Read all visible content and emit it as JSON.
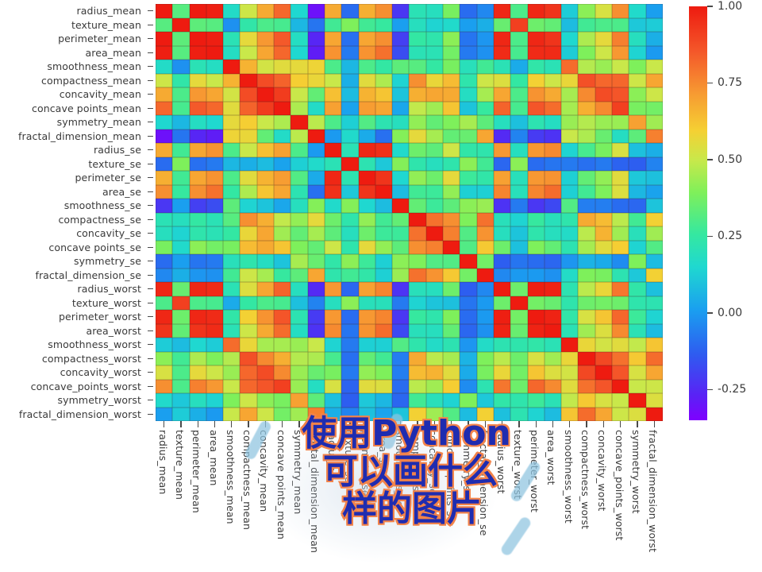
{
  "figure": {
    "axis_tick_color": "#4a4a4a",
    "label_color": "#3a3a3a",
    "colormap": "jet"
  },
  "overlay": {
    "lines": [
      "使用Python",
      "可以画什么",
      "样的图片"
    ],
    "fill_color": "#1f2cb0",
    "stroke_color": "#f2834a"
  },
  "colorbar": {
    "ticks": [
      "1.00",
      "0.75",
      "0.50",
      "0.25",
      "0.00",
      "-0.25"
    ],
    "tick_values": [
      1.0,
      0.75,
      0.5,
      0.25,
      0.0,
      -0.25
    ],
    "vmin": -0.35,
    "vmax": 1.0
  },
  "chart_data": {
    "type": "heatmap",
    "title": "",
    "xlabel": "",
    "ylabel": "",
    "cmap": "jet",
    "vmin": -0.35,
    "vmax": 1.0,
    "grid": false,
    "legend_position": "right",
    "categories": [
      "radius_mean",
      "texture_mean",
      "perimeter_mean",
      "area_mean",
      "smoothness_mean",
      "compactness_mean",
      "concavity_mean",
      "concave points_mean",
      "symmetry_mean",
      "fractal_dimension_mean",
      "radius_se",
      "texture_se",
      "perimeter_se",
      "area_se",
      "smoothness_se",
      "compactness_se",
      "concavity_se",
      "concave points_se",
      "symmetry_se",
      "fractal_dimension_se",
      "radius_worst",
      "texture_worst",
      "perimeter_worst",
      "area_worst",
      "smoothness_worst",
      "compactness_worst",
      "concavity_worst",
      "concave_points_worst",
      "symmetry_worst",
      "fractal_dimension_worst"
    ],
    "x": [
      "radius_mean",
      "texture_mean",
      "perimeter_mean",
      "area_mean",
      "smoothness_mean",
      "compactness_mean",
      "concavity_mean",
      "concave points_mean",
      "symmetry_mean",
      "fractal_dimension_mean",
      "radius_se",
      "texture_se",
      "perimeter_se",
      "area_se",
      "smoothness_se",
      "compactness_se",
      "concavity_se",
      "concave points_se",
      "symmetry_se",
      "fractal_dimension_se",
      "radius_worst",
      "texture_worst",
      "perimeter_worst",
      "area_worst",
      "smoothness_worst",
      "compactness_worst",
      "concavity_worst",
      "concave_points_worst",
      "symmetry_worst",
      "fractal_dimension_worst"
    ],
    "y": [
      "radius_mean",
      "texture_mean",
      "perimeter_mean",
      "area_mean",
      "smoothness_mean",
      "compactness_mean",
      "concavity_mean",
      "concave points_mean",
      "symmetry_mean",
      "fractal_dimension_mean",
      "radius_se",
      "texture_se",
      "perimeter_se",
      "area_se",
      "smoothness_se",
      "compactness_se",
      "concavity_se",
      "concave points_se",
      "symmetry_se",
      "fractal_dimension_se",
      "radius_worst",
      "texture_worst",
      "perimeter_worst",
      "area_worst",
      "smoothness_worst",
      "compactness_worst",
      "concavity_worst",
      "concave_points_worst",
      "symmetry_worst",
      "fractal_dimension_worst"
    ],
    "values": [
      [
        1.0,
        0.32,
        1.0,
        0.99,
        0.17,
        0.51,
        0.68,
        0.82,
        0.15,
        -0.31,
        0.68,
        -0.1,
        0.67,
        0.74,
        -0.22,
        0.21,
        0.19,
        0.38,
        -0.1,
        -0.04,
        0.97,
        0.3,
        0.97,
        0.94,
        0.12,
        0.41,
        0.53,
        0.74,
        0.16,
        0.01
      ],
      [
        0.32,
        1.0,
        0.33,
        0.32,
        -0.02,
        0.24,
        0.3,
        0.29,
        0.07,
        -0.08,
        0.28,
        0.39,
        0.28,
        0.26,
        0.01,
        0.19,
        0.14,
        0.16,
        0.01,
        0.05,
        0.35,
        0.91,
        0.36,
        0.34,
        0.08,
        0.28,
        0.3,
        0.3,
        0.11,
        0.12
      ],
      [
        1.0,
        0.33,
        1.0,
        0.99,
        0.21,
        0.56,
        0.72,
        0.85,
        0.18,
        -0.26,
        0.69,
        -0.09,
        0.69,
        0.74,
        -0.2,
        0.25,
        0.23,
        0.41,
        -0.08,
        -0.01,
        0.97,
        0.3,
        0.97,
        0.94,
        0.15,
        0.46,
        0.56,
        0.77,
        0.19,
        0.05
      ],
      [
        0.99,
        0.32,
        0.99,
        1.0,
        0.18,
        0.5,
        0.69,
        0.82,
        0.15,
        -0.28,
        0.73,
        -0.07,
        0.73,
        0.8,
        -0.17,
        0.21,
        0.21,
        0.37,
        -0.07,
        -0.02,
        0.96,
        0.29,
        0.96,
        0.96,
        0.12,
        0.39,
        0.51,
        0.72,
        0.14,
        0.0
      ],
      [
        0.17,
        -0.02,
        0.21,
        0.18,
        1.0,
        0.66,
        0.52,
        0.55,
        0.56,
        0.58,
        0.3,
        0.07,
        0.3,
        0.25,
        0.33,
        0.32,
        0.25,
        0.38,
        0.2,
        0.28,
        0.21,
        0.04,
        0.24,
        0.21,
        0.81,
        0.47,
        0.43,
        0.5,
        0.39,
        0.5
      ],
      [
        0.51,
        0.24,
        0.56,
        0.5,
        0.66,
        1.0,
        0.88,
        0.83,
        0.6,
        0.57,
        0.5,
        0.05,
        0.55,
        0.46,
        0.14,
        0.74,
        0.57,
        0.64,
        0.23,
        0.51,
        0.54,
        0.25,
        0.59,
        0.51,
        0.57,
        0.87,
        0.82,
        0.82,
        0.51,
        0.69
      ],
      [
        0.68,
        0.3,
        0.72,
        0.69,
        0.52,
        0.88,
        1.0,
        0.92,
        0.5,
        0.34,
        0.63,
        0.08,
        0.66,
        0.62,
        0.1,
        0.67,
        0.69,
        0.68,
        0.18,
        0.45,
        0.69,
        0.3,
        0.73,
        0.68,
        0.45,
        0.75,
        0.88,
        0.86,
        0.41,
        0.51
      ],
      [
        0.82,
        0.29,
        0.85,
        0.82,
        0.55,
        0.83,
        0.92,
        1.0,
        0.46,
        0.17,
        0.7,
        0.02,
        0.71,
        0.69,
        0.03,
        0.49,
        0.44,
        0.62,
        0.1,
        0.26,
        0.83,
        0.29,
        0.86,
        0.81,
        0.45,
        0.67,
        0.75,
        0.91,
        0.38,
        0.37
      ],
      [
        0.15,
        0.07,
        0.18,
        0.15,
        0.56,
        0.6,
        0.5,
        0.46,
        1.0,
        0.48,
        0.3,
        0.13,
        0.31,
        0.22,
        0.19,
        0.42,
        0.34,
        0.39,
        0.45,
        0.33,
        0.19,
        0.09,
        0.22,
        0.18,
        0.43,
        0.47,
        0.43,
        0.43,
        0.7,
        0.44
      ],
      [
        -0.31,
        -0.08,
        -0.26,
        -0.28,
        0.58,
        0.57,
        0.34,
        0.17,
        0.48,
        1.0,
        0.0,
        0.16,
        0.04,
        -0.09,
        0.4,
        0.56,
        0.45,
        0.34,
        0.35,
        0.69,
        -0.25,
        -0.05,
        -0.21,
        -0.23,
        0.5,
        0.46,
        0.35,
        0.18,
        0.33,
        0.77
      ],
      [
        0.68,
        0.28,
        0.69,
        0.73,
        0.3,
        0.5,
        0.63,
        0.7,
        0.3,
        0.0,
        1.0,
        0.21,
        0.97,
        0.95,
        0.16,
        0.36,
        0.33,
        0.51,
        0.24,
        0.23,
        0.72,
        0.19,
        0.72,
        0.75,
        0.14,
        0.29,
        0.38,
        0.53,
        0.09,
        0.05
      ],
      [
        -0.1,
        0.39,
        -0.09,
        -0.07,
        0.07,
        0.05,
        0.08,
        0.02,
        0.13,
        0.16,
        0.21,
        1.0,
        0.22,
        0.11,
        0.4,
        0.23,
        0.19,
        0.23,
        0.41,
        0.28,
        -0.11,
        0.41,
        -0.1,
        -0.08,
        -0.07,
        -0.09,
        -0.07,
        -0.12,
        -0.13,
        -0.05
      ],
      [
        0.67,
        0.28,
        0.69,
        0.73,
        0.3,
        0.55,
        0.66,
        0.71,
        0.31,
        0.04,
        0.97,
        0.22,
        1.0,
        0.94,
        0.15,
        0.42,
        0.36,
        0.56,
        0.27,
        0.24,
        0.7,
        0.2,
        0.72,
        0.73,
        0.13,
        0.34,
        0.42,
        0.55,
        0.11,
        0.09
      ],
      [
        0.74,
        0.26,
        0.74,
        0.8,
        0.25,
        0.46,
        0.62,
        0.69,
        0.22,
        -0.09,
        0.95,
        0.11,
        0.94,
        1.0,
        0.08,
        0.28,
        0.27,
        0.42,
        0.13,
        0.13,
        0.76,
        0.2,
        0.76,
        0.81,
        0.13,
        0.28,
        0.39,
        0.54,
        0.07,
        0.02
      ],
      [
        -0.22,
        0.01,
        -0.2,
        -0.17,
        0.33,
        0.14,
        0.1,
        0.03,
        0.19,
        0.4,
        0.16,
        0.4,
        0.15,
        0.08,
        1.0,
        0.34,
        0.27,
        0.33,
        0.41,
        0.43,
        -0.23,
        -0.07,
        -0.22,
        -0.18,
        0.31,
        -0.06,
        -0.06,
        -0.1,
        -0.11,
        0.1
      ],
      [
        0.21,
        0.19,
        0.25,
        0.21,
        0.32,
        0.74,
        0.67,
        0.49,
        0.42,
        0.56,
        0.36,
        0.23,
        0.42,
        0.28,
        0.34,
        1.0,
        0.8,
        0.74,
        0.39,
        0.8,
        0.2,
        0.14,
        0.26,
        0.2,
        0.23,
        0.68,
        0.64,
        0.48,
        0.28,
        0.59
      ],
      [
        0.19,
        0.14,
        0.23,
        0.21,
        0.25,
        0.57,
        0.69,
        0.44,
        0.34,
        0.45,
        0.33,
        0.19,
        0.36,
        0.27,
        0.27,
        0.8,
        1.0,
        0.77,
        0.31,
        0.73,
        0.19,
        0.1,
        0.23,
        0.19,
        0.17,
        0.48,
        0.66,
        0.44,
        0.2,
        0.44
      ],
      [
        0.38,
        0.16,
        0.41,
        0.37,
        0.38,
        0.64,
        0.68,
        0.62,
        0.39,
        0.34,
        0.51,
        0.23,
        0.56,
        0.42,
        0.33,
        0.74,
        0.77,
        1.0,
        0.31,
        0.61,
        0.36,
        0.09,
        0.39,
        0.34,
        0.22,
        0.45,
        0.55,
        0.6,
        0.14,
        0.31
      ],
      [
        -0.1,
        0.01,
        -0.08,
        -0.07,
        0.2,
        0.23,
        0.18,
        0.1,
        0.45,
        0.35,
        0.24,
        0.41,
        0.27,
        0.13,
        0.41,
        0.39,
        0.31,
        0.31,
        1.0,
        0.37,
        -0.13,
        -0.08,
        -0.1,
        -0.11,
        -0.01,
        0.06,
        0.04,
        -0.03,
        0.39,
        0.08
      ],
      [
        -0.04,
        0.05,
        -0.01,
        -0.02,
        0.28,
        0.51,
        0.45,
        0.26,
        0.33,
        0.69,
        0.23,
        0.28,
        0.24,
        0.13,
        0.43,
        0.8,
        0.73,
        0.61,
        0.37,
        1.0,
        -0.04,
        -0.0,
        -0.0,
        -0.02,
        0.17,
        0.39,
        0.38,
        0.22,
        0.11,
        0.59
      ],
      [
        0.97,
        0.35,
        0.97,
        0.96,
        0.21,
        0.54,
        0.69,
        0.83,
        0.19,
        -0.25,
        0.72,
        -0.11,
        0.7,
        0.76,
        -0.23,
        0.2,
        0.19,
        0.36,
        -0.13,
        -0.04,
        1.0,
        0.36,
        0.99,
        0.98,
        0.22,
        0.48,
        0.57,
        0.79,
        0.24,
        0.09
      ],
      [
        0.3,
        0.91,
        0.3,
        0.29,
        0.04,
        0.25,
        0.3,
        0.29,
        0.09,
        -0.05,
        0.19,
        0.41,
        0.2,
        0.2,
        -0.07,
        0.14,
        0.1,
        0.09,
        -0.08,
        -0.0,
        0.36,
        1.0,
        0.37,
        0.35,
        0.23,
        0.36,
        0.37,
        0.36,
        0.23,
        0.22
      ],
      [
        0.97,
        0.36,
        0.97,
        0.96,
        0.24,
        0.59,
        0.73,
        0.86,
        0.22,
        -0.21,
        0.72,
        -0.1,
        0.72,
        0.76,
        -0.22,
        0.26,
        0.23,
        0.39,
        -0.1,
        -0.0,
        0.99,
        0.37,
        1.0,
        0.98,
        0.24,
        0.53,
        0.62,
        0.82,
        0.27,
        0.14
      ],
      [
        0.94,
        0.34,
        0.94,
        0.96,
        0.21,
        0.51,
        0.68,
        0.81,
        0.18,
        -0.23,
        0.75,
        -0.08,
        0.73,
        0.81,
        -0.18,
        0.2,
        0.19,
        0.34,
        -0.11,
        -0.02,
        0.98,
        0.35,
        0.98,
        1.0,
        0.21,
        0.44,
        0.54,
        0.75,
        0.21,
        0.08
      ],
      [
        0.12,
        0.08,
        0.15,
        0.12,
        0.81,
        0.57,
        0.45,
        0.45,
        0.43,
        0.5,
        0.14,
        -0.07,
        0.13,
        0.13,
        0.31,
        0.23,
        0.17,
        0.22,
        -0.01,
        0.17,
        0.22,
        0.23,
        0.24,
        0.21,
        1.0,
        0.57,
        0.52,
        0.55,
        0.49,
        0.62
      ],
      [
        0.41,
        0.28,
        0.46,
        0.39,
        0.47,
        0.87,
        0.75,
        0.67,
        0.47,
        0.46,
        0.29,
        -0.09,
        0.34,
        0.28,
        -0.06,
        0.68,
        0.48,
        0.45,
        0.06,
        0.39,
        0.48,
        0.36,
        0.53,
        0.44,
        0.57,
        1.0,
        0.89,
        0.8,
        0.61,
        0.81
      ],
      [
        0.53,
        0.3,
        0.56,
        0.51,
        0.43,
        0.82,
        0.88,
        0.75,
        0.43,
        0.35,
        0.38,
        -0.07,
        0.42,
        0.39,
        -0.06,
        0.64,
        0.66,
        0.55,
        0.04,
        0.38,
        0.57,
        0.37,
        0.62,
        0.54,
        0.52,
        0.89,
        1.0,
        0.86,
        0.53,
        0.69
      ],
      [
        0.74,
        0.3,
        0.77,
        0.72,
        0.5,
        0.82,
        0.86,
        0.91,
        0.43,
        0.18,
        0.53,
        -0.12,
        0.55,
        0.54,
        -0.1,
        0.48,
        0.44,
        0.6,
        -0.03,
        0.22,
        0.79,
        0.36,
        0.82,
        0.75,
        0.55,
        0.8,
        0.86,
        1.0,
        0.5,
        0.51
      ],
      [
        0.16,
        0.11,
        0.19,
        0.14,
        0.39,
        0.51,
        0.41,
        0.38,
        0.7,
        0.33,
        0.09,
        -0.13,
        0.11,
        0.07,
        -0.11,
        0.28,
        0.2,
        0.14,
        0.39,
        0.11,
        0.24,
        0.23,
        0.27,
        0.21,
        0.49,
        0.61,
        0.53,
        0.5,
        1.0,
        0.54
      ],
      [
        0.01,
        0.12,
        0.05,
        0.0,
        0.5,
        0.69,
        0.51,
        0.37,
        0.44,
        0.77,
        0.05,
        -0.05,
        0.09,
        0.02,
        0.1,
        0.59,
        0.44,
        0.31,
        0.08,
        0.59,
        0.09,
        0.22,
        0.14,
        0.08,
        0.62,
        0.81,
        0.69,
        0.51,
        0.54,
        1.0
      ]
    ]
  }
}
